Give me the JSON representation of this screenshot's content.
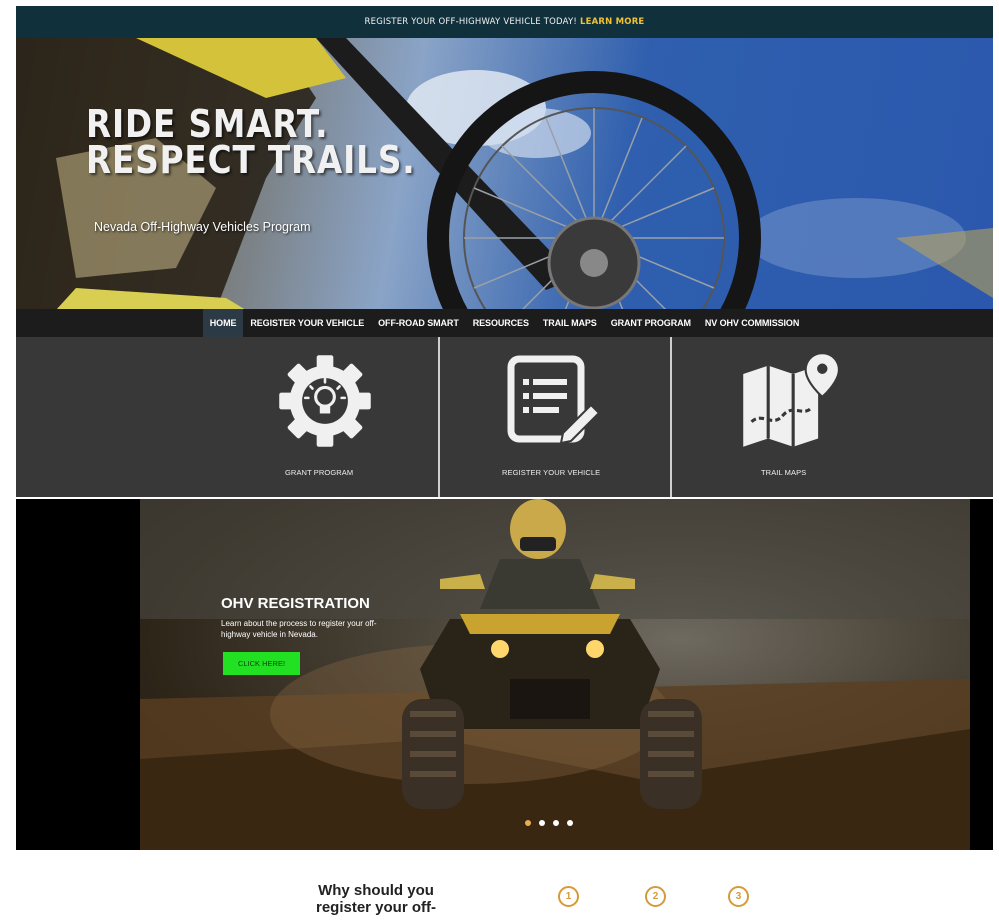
{
  "announcement": {
    "text": "REGISTER YOUR OFF-HIGHWAY VEHICLE TODAY!",
    "link": "LEARN MORE"
  },
  "hero": {
    "title_line1": "RIDE SMART.",
    "title_line2": "RESPECT TRAILS.",
    "subtitle": "Nevada Off-Highway Vehicles Program"
  },
  "nav": {
    "items": [
      {
        "label": "HOME",
        "active": true
      },
      {
        "label": "REGISTER YOUR VEHICLE"
      },
      {
        "label": "OFF-ROAD SMART"
      },
      {
        "label": "RESOURCES"
      },
      {
        "label": "TRAIL MAPS"
      },
      {
        "label": "GRANT PROGRAM"
      },
      {
        "label": "NV OHV COMMISSION"
      }
    ]
  },
  "tiles": [
    {
      "label": "GRANT PROGRAM",
      "icon": "gear-lightbulb-icon"
    },
    {
      "label": "REGISTER YOUR VEHICLE",
      "icon": "form-pencil-icon"
    },
    {
      "label": "TRAIL MAPS",
      "icon": "map-pin-icon"
    }
  ],
  "slider": {
    "title": "OHV REGISTRATION",
    "description": "Learn about the process to register your off-highway vehicle in Nevada.",
    "button": "CLICK HERE!",
    "slide_count": 4,
    "active_slide": 1
  },
  "why": {
    "heading": "Why should you register your off-",
    "steps": [
      "1",
      "2",
      "3"
    ]
  },
  "colors": {
    "topbar": "#10303c",
    "link_accent": "#f1c232",
    "tile_bg": "#383838",
    "cta_green": "#22e022",
    "step_orange": "#d59a3a"
  }
}
